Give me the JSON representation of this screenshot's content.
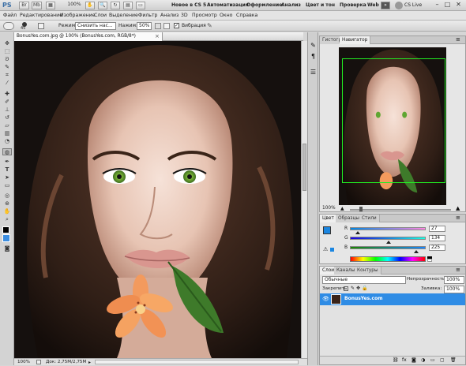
{
  "app": {
    "logo": "PS"
  },
  "titlebar": {
    "zoom": "100%",
    "workspaces": [
      "Новое в CS 5",
      "Автоматизация",
      "Оформление",
      "Анализ",
      "Цвет и тон",
      "Проверка",
      "Web"
    ],
    "cs_live": "CS Live",
    "buttons": {
      "minimize": "–",
      "restore": "□",
      "close": "✕"
    }
  },
  "menu": {
    "items": [
      "Файл",
      "Редактирование",
      "Изображение",
      "Слои",
      "Выделение",
      "Фильтр",
      "Анализ",
      "3D",
      "Просмотр",
      "Окно",
      "Справка"
    ]
  },
  "options": {
    "brush_size": "45",
    "mode_label": "Режим:",
    "mode_value": "Снизить нас...",
    "pressure_label": "Нажим:",
    "pressure_value": "50%",
    "vibrance_label": "Вибрация"
  },
  "document": {
    "tab_title": "BonusYes.com.jpg @ 100% (BonusYes.com, RGB/8*)",
    "zoom": "100%",
    "doc_size": "Док: 2,75M/2,75M"
  },
  "navigator": {
    "tabs": [
      "Гистограмма",
      "Навигатор"
    ],
    "zoom": "100%"
  },
  "color": {
    "tabs": [
      "Цвет",
      "Образцы",
      "Стили"
    ],
    "r_label": "R",
    "g_label": "G",
    "b_label": "B",
    "r": "27",
    "g": "134",
    "b": "225",
    "fg": "#1b86e1"
  },
  "layers": {
    "tabs": [
      "Слои",
      "Каналы",
      "Контуры"
    ],
    "blend_mode": "Обычные",
    "opacity_label": "Непрозрачность:",
    "opacity": "100%",
    "lock_label": "Закрепить:",
    "fill_label": "Заливка:",
    "fill": "100%",
    "items": [
      {
        "name": "BonusYes.com"
      }
    ]
  },
  "colors": {
    "accent": "#3d8ee0",
    "layer_selected": "#2f8ce5",
    "foreground": "#3a86d6"
  }
}
